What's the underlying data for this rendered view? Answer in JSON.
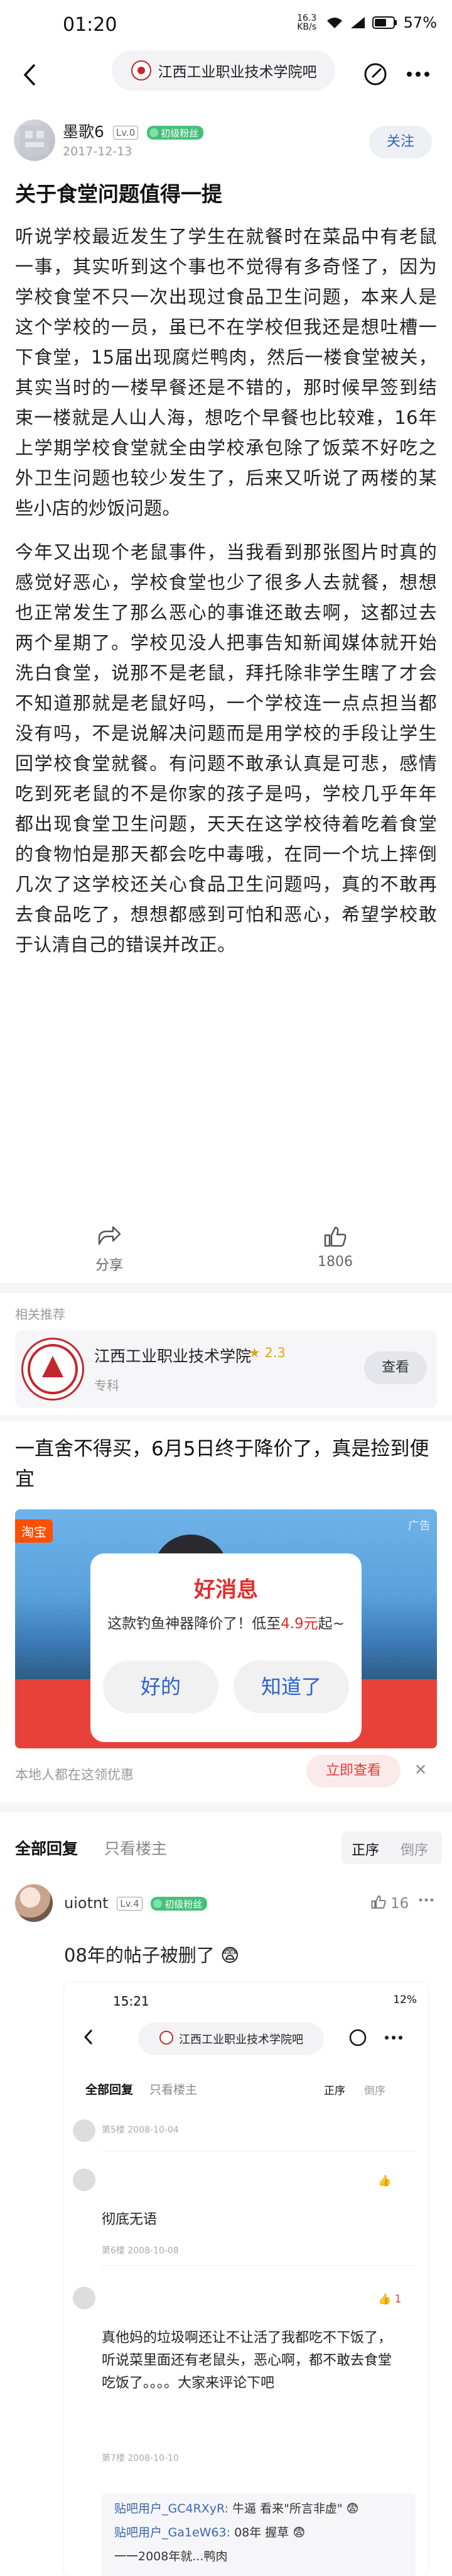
{
  "status_bar": {
    "time": "01:20",
    "network": "16.3 KB/s",
    "battery": "57%"
  },
  "nav": {
    "forum_name": "江西工业职业技术学院吧"
  },
  "post": {
    "author": "墨歌6",
    "level": "Lv.0",
    "fan_badge": "初级粉丝",
    "date": "2017-12-13",
    "follow_label": "关注",
    "title": "关于食堂问题值得一提",
    "paragraphs": [
      "听说学校最近发生了学生在就餐时在菜品中有老鼠一事，其实听到这个事也不觉得有多奇怪了，因为学校食堂不只一次出现过食品卫生问题，本来人是这个学校的一员，虽已不在学校但我还是想吐槽一下食堂，15届出现腐烂鸭肉，然后一楼食堂被关，其实当时的一楼早餐还是不错的，那时候早签到结束一楼就是人山人海，想吃个早餐也比较难，16年上学期学校食堂就全由学校承包除了饭菜不好吃之外卫生问题也较少发生了，后来又听说了两楼的某些小店的炒饭问题。",
      "今年又出现个老鼠事件，当我看到那张图片时真的感觉好恶心，学校食堂也少了很多人去就餐，想想也正常发生了那么恶心的事谁还敢去啊，这都过去两个星期了。学校见没人把事告知新闻媒体就开始洗白食堂，说那不是老鼠，拜托除非学生瞎了才会不知道那就是老鼠好吗，一个学校连一点点担当都没有吗，不是说解决问题而是用学校的手段让学生回学校食堂就餐。有问题不敢承认真是可悲，感情吃到死老鼠的不是你家的孩子是吗，学校几乎年年都出现食堂卫生问题，天天在这学校待着吃着食堂的食物怕是那天都会吃中毒哦，在同一个坑上摔倒几次了这学校还关心食品卫生问题吗，真的不敢再去食品吃了，想想都感到可怕和恶心，希望学校敢于认清自己的错误并改正。"
    ],
    "share_label": "分享",
    "like_count": "1806"
  },
  "recommend": {
    "section_label": "相关推荐",
    "name": "江西工业职业技术学院",
    "score": "2.3",
    "tag": "专科",
    "view_label": "查看"
  },
  "ad": {
    "title": "一直舍不得买，6月5日终于降价了，真是捡到便宜",
    "platform": "淘宝",
    "ad_tag": "广告",
    "popup_heading": "好消息",
    "popup_text_prefix": "这款钓鱼神器降价了！低至",
    "popup_price": "4.9元",
    "popup_text_suffix": "起~",
    "popup_ok": "好的",
    "popup_know": "知道了",
    "footer": "本地人都在这领优惠",
    "buy_label": "立即查看",
    "close": "✕"
  },
  "replies_header": {
    "all_label": "全部回复",
    "owner_only_label": "只看楼主",
    "sort_asc": "正序",
    "sort_desc": "倒序"
  },
  "reply": {
    "user": "uiotnt",
    "level": "Lv.4",
    "fan_badge": "初级粉丝",
    "like_count": "16",
    "text": "08年的帖子被删了 😨"
  },
  "embedded_screenshot": {
    "time": "15:21",
    "battery": "12%",
    "forum_name": "江西工业职业技术学院吧",
    "all_label": "全部回复",
    "owner_only_label": "只看楼主",
    "sort_asc": "正序",
    "sort_desc": "倒序",
    "floors": [
      {
        "floor": "第5楼 2008-10-04",
        "text": ""
      },
      {
        "floor": "第6楼 2008-10-08",
        "text": "彻底无语"
      },
      {
        "floor": "第7楼 2008-10-10",
        "text": "真他妈的垃圾啊还让不让活了我都吃不下饭了，听说菜里面还有老鼠头，恶心啊，都不敢去食堂吃饭了。。。。大家来评论下吧",
        "like": "1"
      }
    ],
    "sub_replies": [
      {
        "user": "贴吧用户_GC4RXyR:",
        "text": "牛逼 看来\"所言非虚\" 😨"
      },
      {
        "user": "贴吧用户_Ga1eW63:",
        "text": "08年 握草 😨"
      },
      {
        "user": "",
        "text": "一一2008年就...鸭肉"
      }
    ]
  }
}
